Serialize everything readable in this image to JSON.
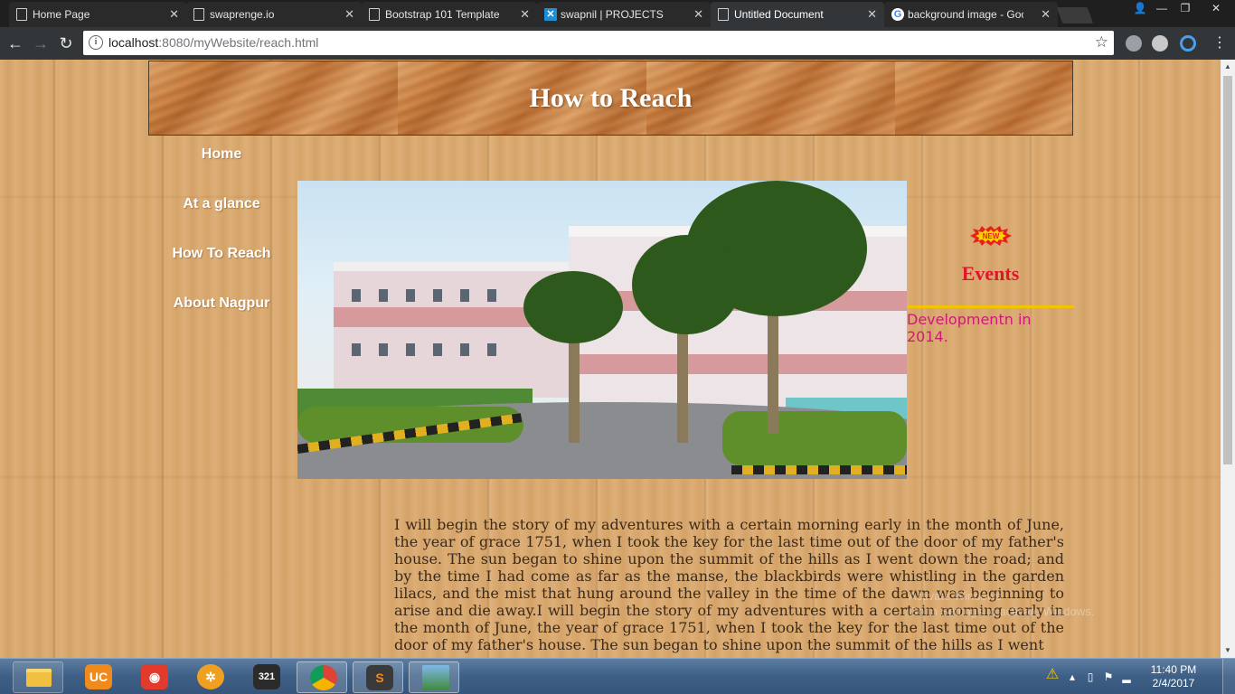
{
  "browser": {
    "tabs": [
      {
        "label": "Home Page",
        "favicon": "page-icon",
        "active": false
      },
      {
        "label": "swaprenge.io",
        "favicon": "page-icon",
        "active": false
      },
      {
        "label": "Bootstrap 101 Template",
        "favicon": "page-icon",
        "active": false
      },
      {
        "label": "swapnil | PROJECTS",
        "favicon": "x-logo-icon",
        "active": false
      },
      {
        "label": "Untitled Document",
        "favicon": "page-icon",
        "active": true
      },
      {
        "label": "background image - Goo",
        "favicon": "google-icon",
        "active": false
      }
    ],
    "url_host": "localhost",
    "url_rest": ":8080/myWebsite/reach.html"
  },
  "page": {
    "banner_title": "How to Reach",
    "nav": [
      {
        "label": "Home"
      },
      {
        "label": "At a glance"
      },
      {
        "label": "How To Reach"
      },
      {
        "label": "About Nagpur"
      }
    ],
    "events": {
      "badge": "NEW",
      "title": "Events",
      "item": "Developmentn in 2014."
    },
    "story": "I will begin the story of my adventures with a certain morning early in the month of June, the year of grace 1751, when I took the key for the last time out of the door of my father's house. The sun began to shine upon the summit of the hills as I went down the road; and by the time I had come as far as the manse, the blackbirds were whistling in the garden lilacs, and the mist that hung around the valley in the time of the dawn was beginning to arise and die away.I will begin the story of my adventures with a certain morning early in the month of June, the year of grace 1751, when I took the key for the last time out of the door of my father's house. The sun began to shine upon the summit of the hills as I went",
    "watermark_line1": "Activate Windows",
    "watermark_line2": "Go to Settings to activate Windows."
  },
  "taskbar": {
    "apps": [
      "uc-browser-icon",
      "recorder-icon",
      "ship-wheel-icon",
      "media-player-classic-icon",
      "chrome-icon",
      "sublime-text-icon",
      "photo-viewer-icon"
    ],
    "time": "11:40 PM",
    "date": "2/4/2017"
  },
  "colors": {
    "events_title": "#e0142a",
    "events_item": "#d0187a",
    "events_rule": "#f4c400"
  }
}
